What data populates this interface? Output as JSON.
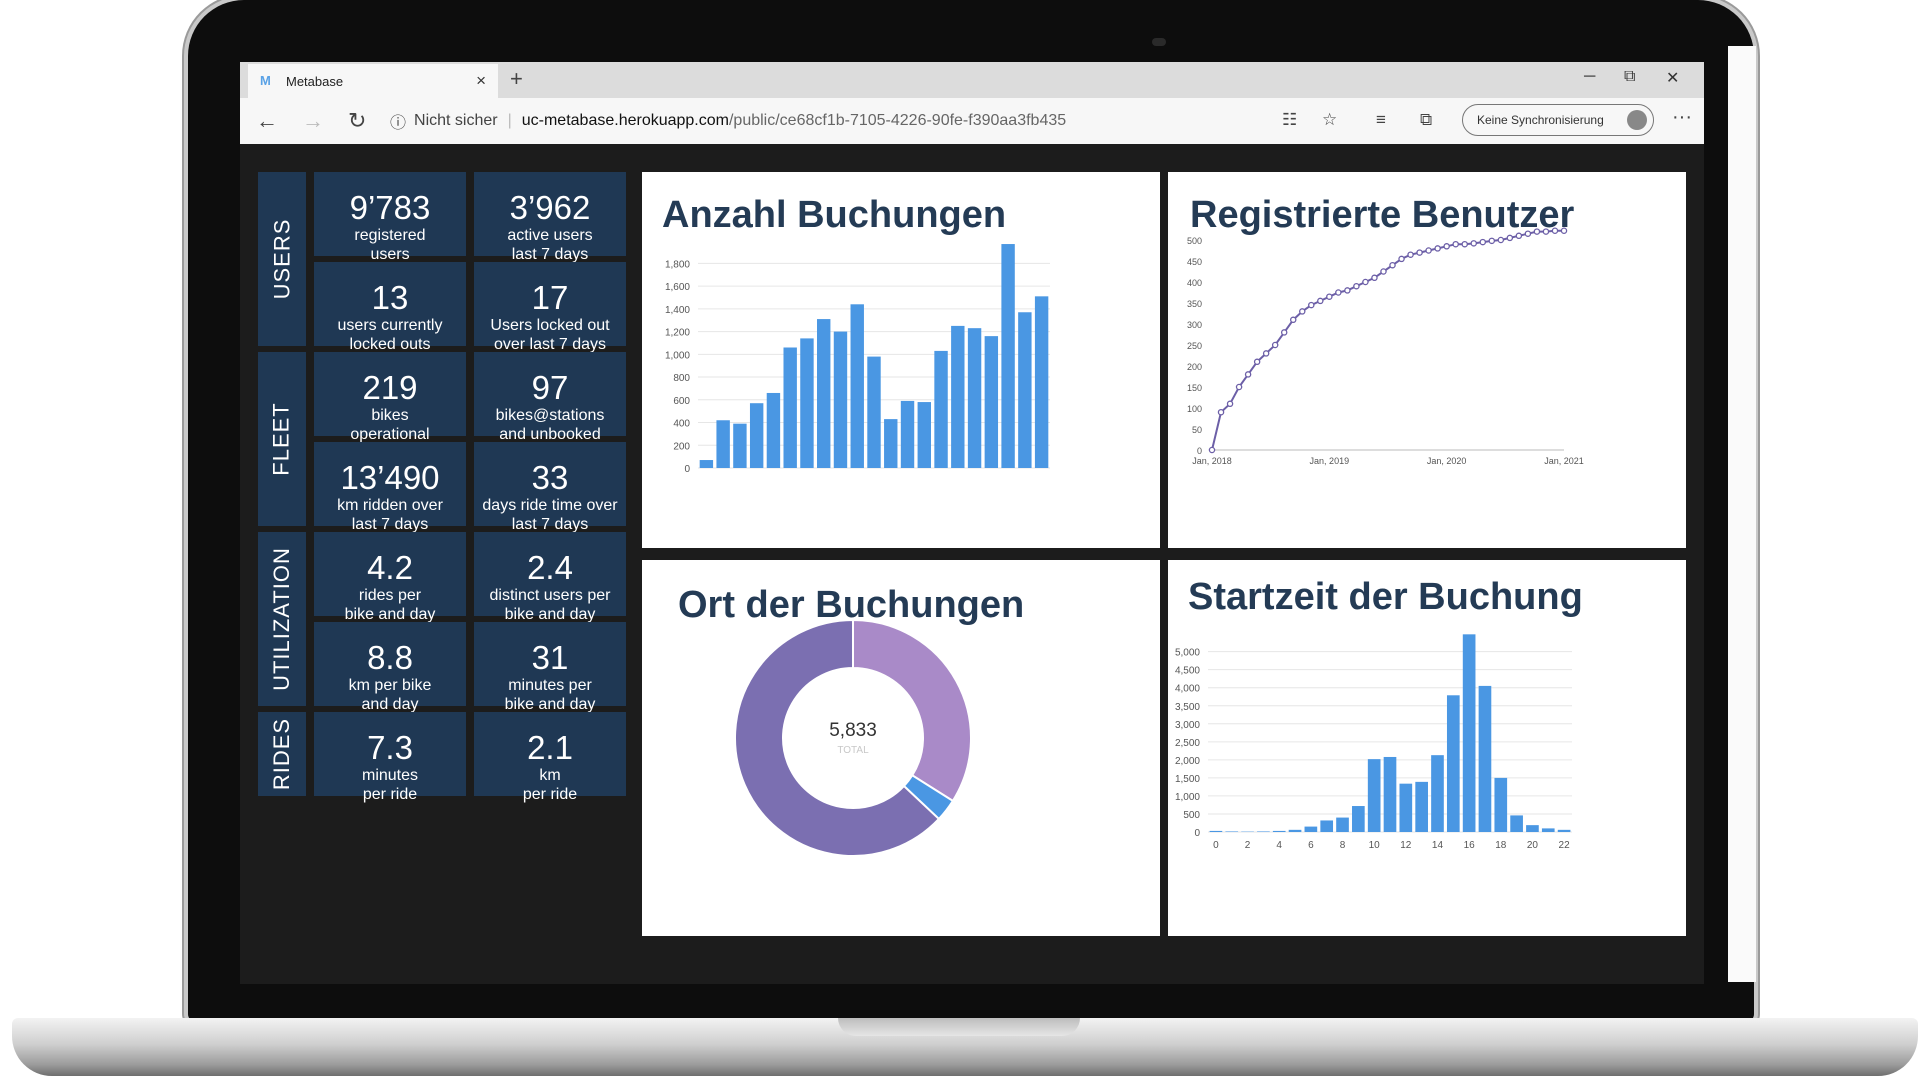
{
  "browser": {
    "tab_title": "Metabase",
    "tab_logo": "M",
    "tab_close": "×",
    "new_tab": "+",
    "security_label": "Nicht sicher",
    "url_host": "uc-metabase.herokuapp.com",
    "url_path": "/public/ce68cf1b-7105-4226-90fe-f390aa3fb435",
    "sync_label": "Keine Synchronisierung",
    "more": "···"
  },
  "sections": [
    {
      "label": "USERS"
    },
    {
      "label": "FLEET"
    },
    {
      "label": "UTILIZATION"
    },
    {
      "label": "RIDES"
    }
  ],
  "cards": [
    {
      "value": "9’783",
      "label": "registered\nusers"
    },
    {
      "value": "3’962",
      "label": "active users\nlast 7 days"
    },
    {
      "value": "13",
      "label": "users currently\nlocked outs"
    },
    {
      "value": "17",
      "label": "Users locked out\nover last 7 days"
    },
    {
      "value": "219",
      "label": "bikes\noperational"
    },
    {
      "value": "97",
      "label": "bikes@stations\nand unbooked"
    },
    {
      "value": "13’490",
      "label": "km ridden over\nlast 7 days"
    },
    {
      "value": "33",
      "label": "days ride time over\nlast 7 days"
    },
    {
      "value": "4.2",
      "label": "rides per\nbike and day"
    },
    {
      "value": "2.4",
      "label": "distinct users per\nbike and day"
    },
    {
      "value": "8.8",
      "label": "km per bike\nand day"
    },
    {
      "value": "31",
      "label": "minutes per\nbike and day"
    },
    {
      "value": "7.3",
      "label": "minutes\nper ride"
    },
    {
      "value": "2.1",
      "label": "km\nper ride"
    }
  ],
  "colors": {
    "card_bg": "#1f3854",
    "bar": "#4a97e3",
    "line": "#6c5fa7",
    "donut_main": "#7b6fb1",
    "donut_second": "#a98ac8",
    "donut_third": "#4a97e3"
  },
  "chart_data": [
    {
      "type": "bar",
      "title": "Anzahl Buchungen",
      "ylim": [
        0,
        1900
      ],
      "yticks": [
        "0",
        "200",
        "400",
        "600",
        "800",
        "1,000",
        "1,200",
        "1,400",
        "1,600",
        "1,800"
      ],
      "values": [
        70,
        420,
        390,
        570,
        660,
        1060,
        1140,
        1310,
        1200,
        1440,
        980,
        430,
        590,
        580,
        1030,
        1250,
        1230,
        1160,
        1970,
        1370,
        1510
      ],
      "grid": true
    },
    {
      "type": "line",
      "title": "Registrierte Benutzer",
      "xticks": [
        "Jan, 2018",
        "Jan, 2019",
        "Jan, 2020",
        "Jan, 2021"
      ],
      "yticks": [
        "0",
        "50",
        "100",
        "150",
        "200",
        "250",
        "300",
        "350",
        "400",
        "450",
        "500"
      ],
      "ylim": [
        0,
        500
      ],
      "values": [
        0,
        90,
        110,
        150,
        180,
        210,
        230,
        250,
        280,
        310,
        330,
        345,
        355,
        365,
        375,
        380,
        390,
        400,
        410,
        425,
        440,
        455,
        465,
        470,
        475,
        480,
        485,
        490,
        490,
        492,
        495,
        498,
        500,
        505,
        510,
        515,
        520,
        520,
        522,
        522
      ]
    },
    {
      "type": "pie",
      "title": "Ort der Buchungen",
      "total_value": "5,833",
      "total_label": "TOTAL",
      "values": [
        1980,
        180,
        3673
      ]
    },
    {
      "type": "bar",
      "title": "Startzeit der Buchung",
      "ylim": [
        0,
        5600
      ],
      "yticks": [
        "0",
        "500",
        "1,000",
        "1,500",
        "2,000",
        "2,500",
        "3,000",
        "3,500",
        "4,000",
        "4,500",
        "5,000"
      ],
      "xticks": [
        "0",
        "2",
        "4",
        "6",
        "8",
        "10",
        "12",
        "14",
        "16",
        "18",
        "20",
        "22"
      ],
      "values": [
        30,
        15,
        10,
        15,
        30,
        60,
        150,
        320,
        400,
        720,
        2020,
        2080,
        1340,
        1390,
        2130,
        3790,
        5480,
        4050,
        1500,
        460,
        190,
        100,
        60
      ],
      "grid": true
    }
  ]
}
